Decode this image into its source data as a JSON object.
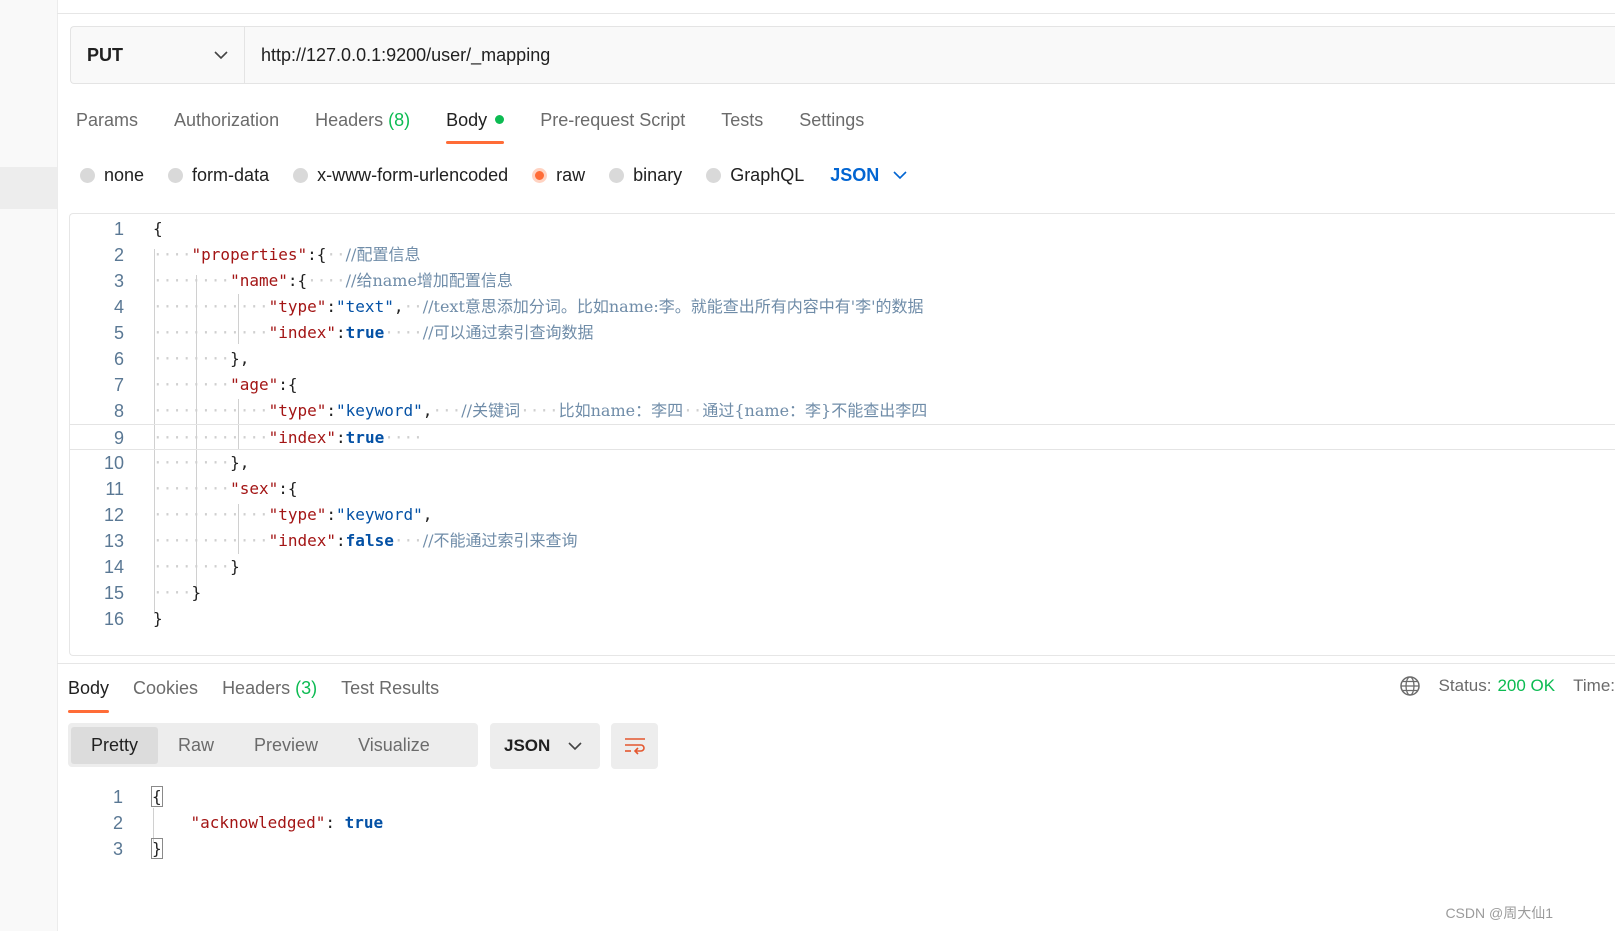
{
  "request": {
    "method": "PUT",
    "url": "http://127.0.0.1:9200/user/_mapping"
  },
  "request_tabs": [
    {
      "label": "Params"
    },
    {
      "label": "Authorization"
    },
    {
      "label": "Headers",
      "count": "(8)"
    },
    {
      "label": "Body",
      "active": true,
      "indicator": "green-dot"
    },
    {
      "label": "Pre-request Script"
    },
    {
      "label": "Tests"
    },
    {
      "label": "Settings"
    }
  ],
  "body_types": {
    "options": [
      "none",
      "form-data",
      "x-www-form-urlencoded",
      "raw",
      "binary",
      "GraphQL"
    ],
    "selected": "raw",
    "language": "JSON"
  },
  "editor": {
    "line_numbers": [
      "1",
      "2",
      "3",
      "4",
      "5",
      "6",
      "7",
      "8",
      "9",
      "10",
      "11",
      "12",
      "13",
      "14",
      "15",
      "16"
    ],
    "lines": {
      "l1": "{",
      "l2": {
        "key": "\"properties\"",
        "after": ":{",
        "comment": "//配置信息"
      },
      "l3": {
        "key": "\"name\"",
        "after": ":{",
        "comment": "//给name增加配置信息"
      },
      "l4": {
        "key": "\"type\"",
        "value": "\"text\"",
        "comment": "//text意思添加分词。比如name:李。就能查出所有内容中有'李'的数据"
      },
      "l5": {
        "key": "\"index\"",
        "value": "true",
        "comment": "//可以通过索引查询数据"
      },
      "l6": "},",
      "l7": {
        "key": "\"age\"",
        "after": ":{"
      },
      "l8": {
        "key": "\"type\"",
        "value": "\"keyword\"",
        "comment1": "//关键词",
        "comment2": "比如name：李四",
        "comment3": "通过{name：李}不能查出李四"
      },
      "l9": {
        "key": "\"index\"",
        "value": "true"
      },
      "l10": "},",
      "l11": {
        "key": "\"sex\"",
        "after": ":{"
      },
      "l12": {
        "key": "\"type\"",
        "value": "\"keyword\""
      },
      "l13": {
        "key": "\"index\"",
        "value": "false",
        "comment": "//不能通过索引来查询"
      },
      "l14": "}",
      "l15": "}",
      "l16": "}"
    }
  },
  "response_tabs": [
    {
      "label": "Body",
      "active": true
    },
    {
      "label": "Cookies"
    },
    {
      "label": "Headers",
      "count": "(3)"
    },
    {
      "label": "Test Results"
    }
  ],
  "response_status": {
    "status_label": "Status:",
    "status_value": "200 OK",
    "time_label": "Time:"
  },
  "response_view": {
    "modes": [
      "Pretty",
      "Raw",
      "Preview",
      "Visualize"
    ],
    "active": "Pretty",
    "format": "JSON"
  },
  "response_body": {
    "line_numbers": [
      "1",
      "2",
      "3"
    ],
    "open": "{",
    "key": "\"acknowledged\"",
    "value": "true",
    "close": "}"
  },
  "watermark": "CSDN @周大仙1",
  "colors": {
    "accent": "#ff6c37",
    "success": "#0cbb52",
    "link": "#0265d2"
  }
}
